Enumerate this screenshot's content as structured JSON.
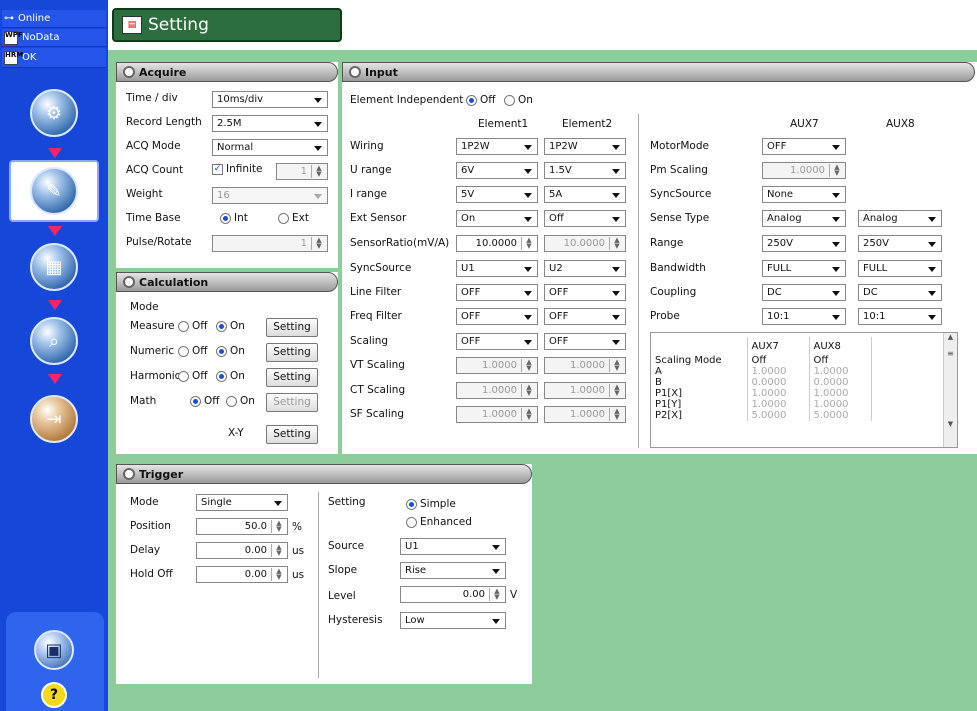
{
  "status": [
    {
      "icon": "online-icon",
      "label": "Online"
    },
    {
      "icon": "wpf-icon",
      "label": "NoData",
      "badge": "WPF"
    },
    {
      "icon": "hrm-icon",
      "label": "OK",
      "badge": "HRM"
    }
  ],
  "title": "Setting",
  "acquire": {
    "header": "Acquire",
    "time_div_label": "Time / div",
    "time_div": "10ms/div",
    "record_length_label": "Record Length",
    "record_length": "2.5M",
    "acq_mode_label": "ACQ Mode",
    "acq_mode": "Normal",
    "acq_count_label": "ACQ Count",
    "infinite_label": "Infinite",
    "acq_count_value": "1",
    "weight_label": "Weight",
    "weight": "16",
    "time_base_label": "Time Base",
    "int_label": "Int",
    "ext_label": "Ext",
    "pulse_label": "Pulse/Rotate",
    "pulse_value": "1"
  },
  "calculation": {
    "header": "Calculation",
    "mode_label": "Mode",
    "rows": [
      {
        "label": "Measure",
        "off": "Off",
        "on": "On",
        "button": "Setting"
      },
      {
        "label": "Numeric",
        "off": "Off",
        "on": "On",
        "button": "Setting"
      },
      {
        "label": "Harmonics",
        "off": "Off",
        "on": "On",
        "button": "Setting"
      },
      {
        "label": "Math",
        "off": "Off",
        "on": "On",
        "button": "Setting"
      }
    ],
    "xy_label": "X-Y",
    "xy_button": "Setting"
  },
  "input": {
    "header": "Input",
    "element_independent": "Element Independent",
    "off": "Off",
    "on": "On",
    "col1": "Element1",
    "col2": "Element2",
    "rows": [
      {
        "label": "Wiring",
        "e1": "1P2W",
        "e2": "1P2W"
      },
      {
        "label": "U range",
        "e1": "6V",
        "e2": "1.5V"
      },
      {
        "label": "I range",
        "e1": "5V",
        "e2": "5A"
      },
      {
        "label": "Ext Sensor",
        "e1": "On",
        "e2": "Off"
      },
      {
        "label": "SensorRatio(mV/A)",
        "e1": "10.0000",
        "e2": "10.0000"
      },
      {
        "label": "SyncSource",
        "e1": "U1",
        "e2": "U2"
      },
      {
        "label": "Line Filter",
        "e1": "OFF",
        "e2": "OFF"
      },
      {
        "label": "Freq Filter",
        "e1": "OFF",
        "e2": "OFF"
      },
      {
        "label": "Scaling",
        "e1": "OFF",
        "e2": "OFF"
      },
      {
        "label": "VT Scaling",
        "e1": "1.0000",
        "e2": "1.0000"
      },
      {
        "label": "CT Scaling",
        "e1": "1.0000",
        "e2": "1.0000"
      },
      {
        "label": "SF Scaling",
        "e1": "1.0000",
        "e2": "1.0000"
      }
    ],
    "aux_col1": "AUX7",
    "aux_col2": "AUX8",
    "aux_rows": [
      {
        "label": "MotorMode",
        "v": "OFF"
      },
      {
        "label": "Pm Scaling",
        "v": "1.0000"
      },
      {
        "label": "SyncSource",
        "v": "None"
      },
      {
        "label": "Sense Type",
        "a7": "Analog",
        "a8": "Analog"
      },
      {
        "label": "Range",
        "a7": "250V",
        "a8": "250V"
      },
      {
        "label": "Bandwidth",
        "a7": "FULL",
        "a8": "FULL"
      },
      {
        "label": "Coupling",
        "a7": "DC",
        "a8": "DC"
      },
      {
        "label": "Probe",
        "a7": "10:1",
        "a8": "10:1"
      }
    ],
    "grid": {
      "headers": [
        "",
        "AUX7",
        "AUX8"
      ],
      "rows": [
        [
          "Scaling Mode",
          "Off",
          "Off"
        ],
        [
          "A",
          "1.0000",
          "1.0000"
        ],
        [
          "B",
          "0.0000",
          "0.0000"
        ],
        [
          "P1[X]",
          "1.0000",
          "1.0000"
        ],
        [
          "P1[Y]",
          "1.0000",
          "1.0000"
        ],
        [
          "P2[X]",
          "5.0000",
          "5.0000"
        ]
      ]
    }
  },
  "trigger": {
    "header": "Trigger",
    "mode_label": "Mode",
    "mode": "Single",
    "position_label": "Position",
    "position": "50.0",
    "position_unit": "%",
    "delay_label": "Delay",
    "delay": "0.00",
    "delay_unit": "us",
    "holdoff_label": "Hold Off",
    "holdoff": "0.00",
    "holdoff_unit": "us",
    "setting_label": "Setting",
    "simple": "Simple",
    "enhanced": "Enhanced",
    "source_label": "Source",
    "source": "U1",
    "slope_label": "Slope",
    "slope": "Rise",
    "level_label": "Level",
    "level": "0.00",
    "level_unit": "V",
    "hysteresis_label": "Hysteresis",
    "hysteresis": "Low"
  },
  "help_glyph": "?"
}
